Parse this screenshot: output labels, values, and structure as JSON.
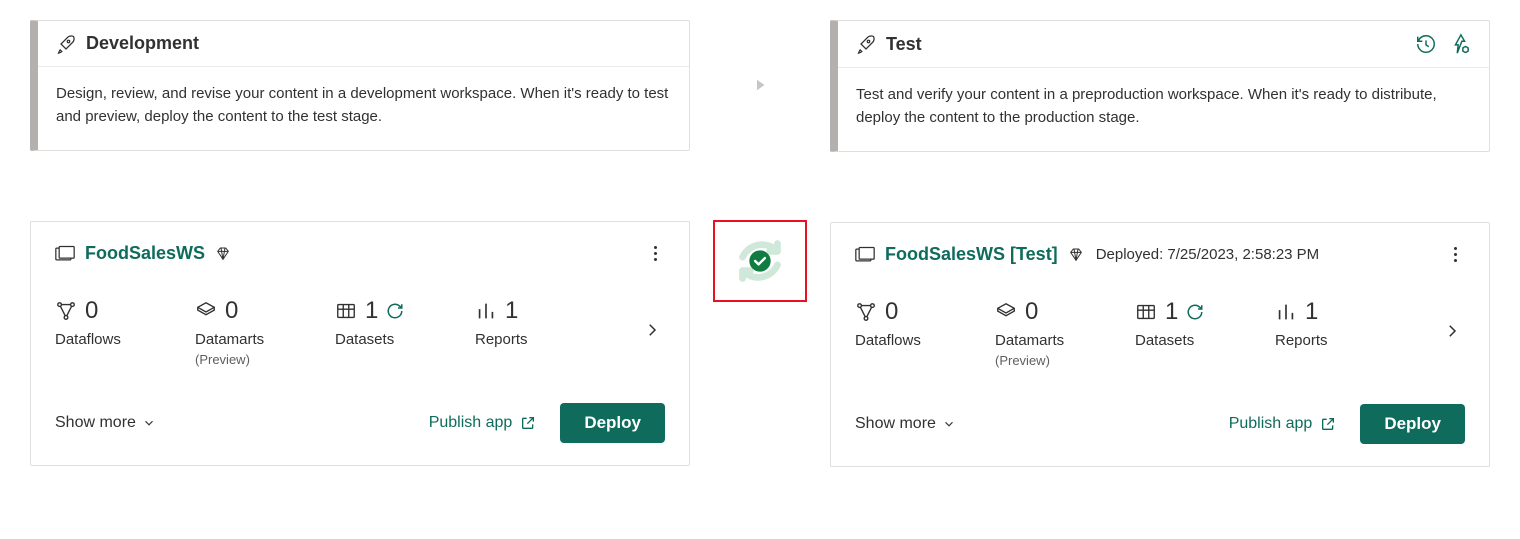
{
  "colors": {
    "accent": "#0f6b5c",
    "border": "#e1dfdd",
    "danger": "#e81123"
  },
  "stages": {
    "dev": {
      "title": "Development",
      "desc": "Design, review, and revise your content in a development workspace. When it's ready to test and preview, deploy the content to the test stage.",
      "workspace": {
        "name": "FoodSalesWS",
        "premium": true,
        "metrics": {
          "dataflows": {
            "count": "0",
            "label": "Dataflows"
          },
          "datamarts": {
            "count": "0",
            "label": "Datamarts",
            "sub": "(Preview)"
          },
          "datasets": {
            "count": "1",
            "label": "Datasets",
            "refreshable": true
          },
          "reports": {
            "count": "1",
            "label": "Reports"
          }
        },
        "show_more": "Show more",
        "publish": "Publish app",
        "deploy": "Deploy"
      }
    },
    "test": {
      "title": "Test",
      "desc": "Test and verify your content in a preproduction workspace. When it's ready to distribute, deploy the content to the production stage.",
      "header_icons": {
        "history": "deployment-history-icon",
        "settings": "deployment-settings-icon"
      },
      "workspace": {
        "name": "FoodSalesWS [Test]",
        "premium": true,
        "deployed_label": "Deployed: 7/25/2023, 2:58:23 PM",
        "metrics": {
          "dataflows": {
            "count": "0",
            "label": "Dataflows"
          },
          "datamarts": {
            "count": "0",
            "label": "Datamarts",
            "sub": "(Preview)"
          },
          "datasets": {
            "count": "1",
            "label": "Datasets",
            "refreshable": true
          },
          "reports": {
            "count": "1",
            "label": "Reports"
          }
        },
        "show_more": "Show more",
        "publish": "Publish app",
        "deploy": "Deploy"
      }
    }
  }
}
